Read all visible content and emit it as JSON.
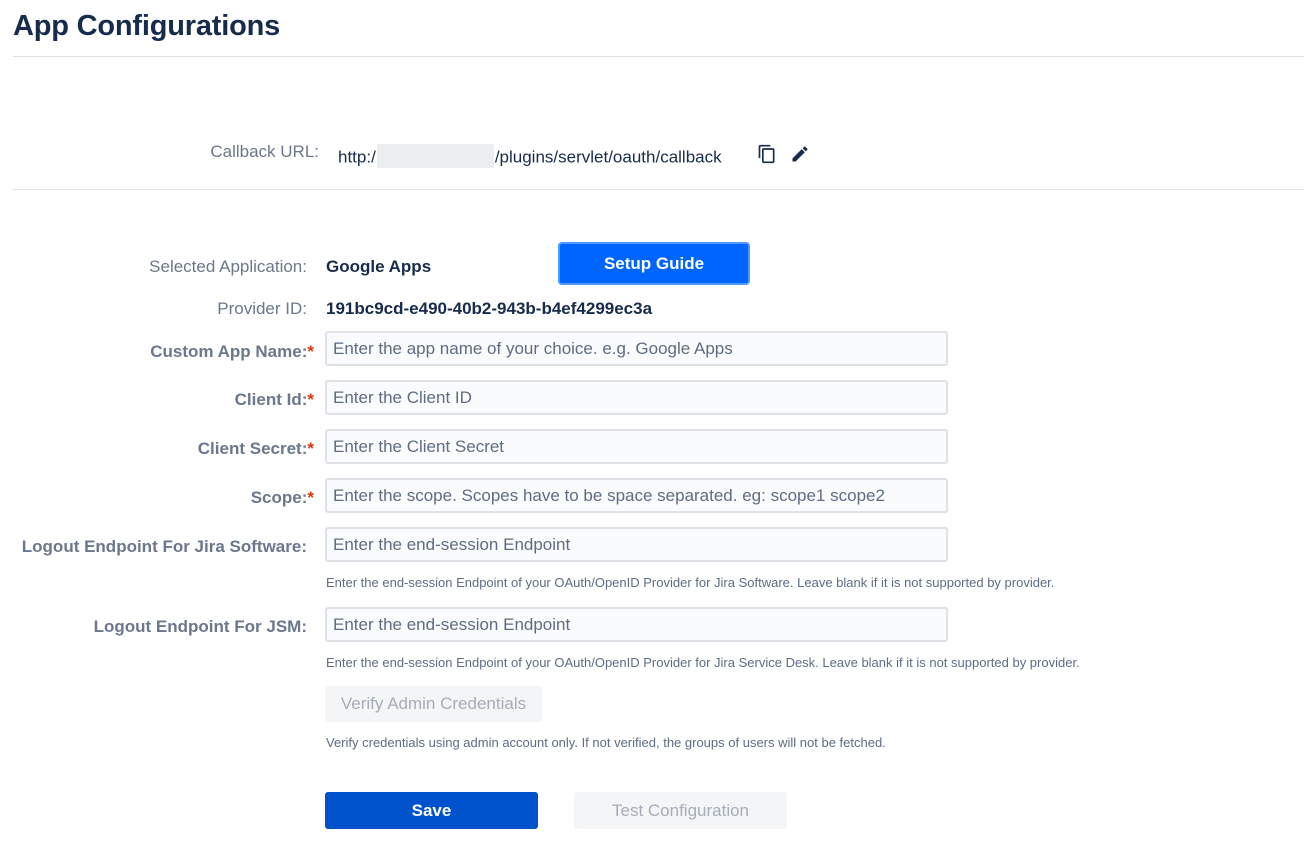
{
  "page": {
    "title": "App Configurations"
  },
  "callback": {
    "label": "Callback URL:",
    "url_prefix": "http:/",
    "url_suffix": "/plugins/servlet/oauth/callback",
    "copy_icon": "copy-icon",
    "edit_icon": "pencil-icon"
  },
  "app": {
    "selected_label": "Selected Application:",
    "selected_value": "Google Apps",
    "setup_guide_label": "Setup Guide",
    "provider_label": "Provider ID:",
    "provider_value": "191bc9cd-e490-40b2-943b-b4ef4299ec3a"
  },
  "form": {
    "required_mark": "*",
    "custom_app_name": {
      "label": "Custom App Name:",
      "placeholder": "Enter the app name of your choice. e.g. Google Apps",
      "value": ""
    },
    "client_id": {
      "label": "Client Id:",
      "placeholder": "Enter the Client ID",
      "value": ""
    },
    "client_secret": {
      "label": "Client Secret:",
      "placeholder": "Enter the Client Secret",
      "value": ""
    },
    "scope": {
      "label": "Scope:",
      "placeholder": "Enter the scope. Scopes have to be space separated. eg: scope1 scope2",
      "value": ""
    },
    "logout_jira": {
      "label": "Logout Endpoint For Jira Software:",
      "placeholder": "Enter the end-session Endpoint",
      "value": "",
      "help": "Enter the end-session Endpoint of your OAuth/OpenID Provider for Jira Software. Leave blank if it is not supported by provider."
    },
    "logout_jsm": {
      "label": "Logout Endpoint For JSM:",
      "placeholder": "Enter the end-session Endpoint",
      "value": "",
      "help": "Enter the end-session Endpoint of your OAuth/OpenID Provider for Jira Service Desk. Leave blank if it is not supported by provider."
    },
    "verify_button_label": "Verify Admin Credentials",
    "verify_help": "Verify credentials using admin account only. If not verified, the groups of users will not be fetched."
  },
  "actions": {
    "save_label": "Save",
    "test_label": "Test Configuration"
  }
}
